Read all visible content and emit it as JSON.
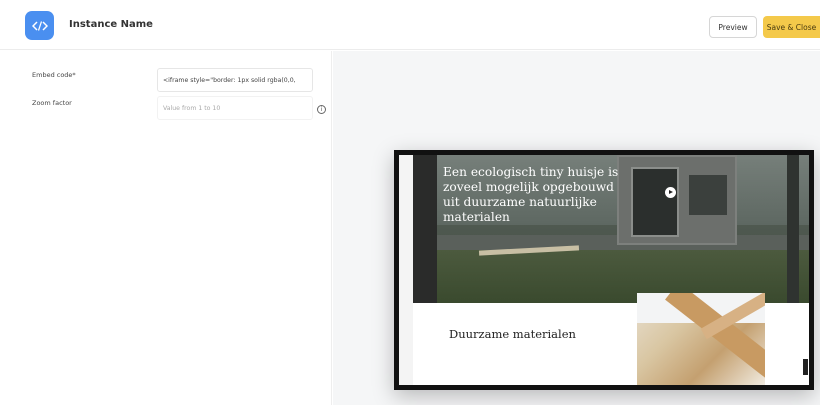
{
  "header": {
    "app_icon": "code-brackets-icon",
    "instance_name": "Instance Name",
    "preview_label": "Preview",
    "save_close_label": "Save & Close"
  },
  "form": {
    "embed_label": "Embed code*",
    "embed_value": "<iframe style=\"border: 1px solid rgba(0,0,",
    "zoom_label": "Zoom factor",
    "zoom_placeholder": "Value from 1 to 10",
    "info_icon": "info-icon"
  },
  "preview": {
    "hero_title": "Een ecologisch tiny huisje is zoveel mogelijk opgebouwd uit duurzame natuurlijke materialen",
    "section_title": "Duurzame materialen"
  },
  "colors": {
    "accent_blue": "#4a8ff0",
    "save_yellow": "#f4c94a"
  }
}
